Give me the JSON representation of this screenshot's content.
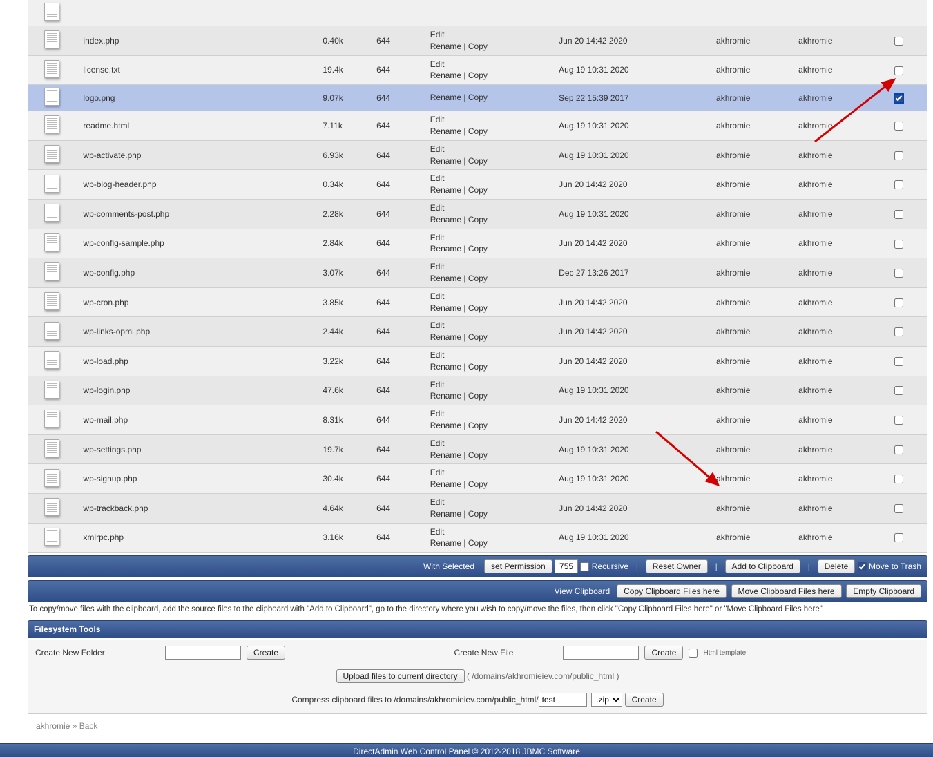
{
  "actions": {
    "edit": "Edit",
    "rename": "Rename",
    "copy": "Copy",
    "sep": " | "
  },
  "files": [
    {
      "name": "index.php",
      "size": "0.40k",
      "perms": "644",
      "hasEdit": true,
      "date": "Jun 20 14:42 2020",
      "uid": "akhromie",
      "gid": "akhromie",
      "selected": false
    },
    {
      "name": "license.txt",
      "size": "19.4k",
      "perms": "644",
      "hasEdit": true,
      "date": "Aug 19 10:31 2020",
      "uid": "akhromie",
      "gid": "akhromie",
      "selected": false
    },
    {
      "name": "logo.png",
      "size": "9.07k",
      "perms": "644",
      "hasEdit": false,
      "date": "Sep 22 15:39 2017",
      "uid": "akhromie",
      "gid": "akhromie",
      "selected": true
    },
    {
      "name": "readme.html",
      "size": "7.11k",
      "perms": "644",
      "hasEdit": true,
      "date": "Aug 19 10:31 2020",
      "uid": "akhromie",
      "gid": "akhromie",
      "selected": false
    },
    {
      "name": "wp-activate.php",
      "size": "6.93k",
      "perms": "644",
      "hasEdit": true,
      "date": "Aug 19 10:31 2020",
      "uid": "akhromie",
      "gid": "akhromie",
      "selected": false
    },
    {
      "name": "wp-blog-header.php",
      "size": "0.34k",
      "perms": "644",
      "hasEdit": true,
      "date": "Jun 20 14:42 2020",
      "uid": "akhromie",
      "gid": "akhromie",
      "selected": false
    },
    {
      "name": "wp-comments-post.php",
      "size": "2.28k",
      "perms": "644",
      "hasEdit": true,
      "date": "Aug 19 10:31 2020",
      "uid": "akhromie",
      "gid": "akhromie",
      "selected": false
    },
    {
      "name": "wp-config-sample.php",
      "size": "2.84k",
      "perms": "644",
      "hasEdit": true,
      "date": "Jun 20 14:42 2020",
      "uid": "akhromie",
      "gid": "akhromie",
      "selected": false
    },
    {
      "name": "wp-config.php",
      "size": "3.07k",
      "perms": "644",
      "hasEdit": true,
      "date": "Dec 27 13:26 2017",
      "uid": "akhromie",
      "gid": "akhromie",
      "selected": false
    },
    {
      "name": "wp-cron.php",
      "size": "3.85k",
      "perms": "644",
      "hasEdit": true,
      "date": "Jun 20 14:42 2020",
      "uid": "akhromie",
      "gid": "akhromie",
      "selected": false
    },
    {
      "name": "wp-links-opml.php",
      "size": "2.44k",
      "perms": "644",
      "hasEdit": true,
      "date": "Jun 20 14:42 2020",
      "uid": "akhromie",
      "gid": "akhromie",
      "selected": false
    },
    {
      "name": "wp-load.php",
      "size": "3.22k",
      "perms": "644",
      "hasEdit": true,
      "date": "Jun 20 14:42 2020",
      "uid": "akhromie",
      "gid": "akhromie",
      "selected": false
    },
    {
      "name": "wp-login.php",
      "size": "47.6k",
      "perms": "644",
      "hasEdit": true,
      "date": "Aug 19 10:31 2020",
      "uid": "akhromie",
      "gid": "akhromie",
      "selected": false
    },
    {
      "name": "wp-mail.php",
      "size": "8.31k",
      "perms": "644",
      "hasEdit": true,
      "date": "Jun 20 14:42 2020",
      "uid": "akhromie",
      "gid": "akhromie",
      "selected": false
    },
    {
      "name": "wp-settings.php",
      "size": "19.7k",
      "perms": "644",
      "hasEdit": true,
      "date": "Aug 19 10:31 2020",
      "uid": "akhromie",
      "gid": "akhromie",
      "selected": false
    },
    {
      "name": "wp-signup.php",
      "size": "30.4k",
      "perms": "644",
      "hasEdit": true,
      "date": "Aug 19 10:31 2020",
      "uid": "akhromie",
      "gid": "akhromie",
      "selected": false
    },
    {
      "name": "wp-trackback.php",
      "size": "4.64k",
      "perms": "644",
      "hasEdit": true,
      "date": "Jun 20 14:42 2020",
      "uid": "akhromie",
      "gid": "akhromie",
      "selected": false
    },
    {
      "name": "xmlrpc.php",
      "size": "3.16k",
      "perms": "644",
      "hasEdit": true,
      "date": "Aug 19 10:31 2020",
      "uid": "akhromie",
      "gid": "akhromie",
      "selected": false
    }
  ],
  "withSelected": {
    "label": "With Selected",
    "setPermission": "set Permission",
    "permValue": "755",
    "recursive": "Recursive",
    "resetOwner": "Reset Owner",
    "addClipboard": "Add to Clipboard",
    "delete": "Delete",
    "moveTrash": "Move to Trash"
  },
  "clipboardBar": {
    "view": "View Clipboard",
    "copyHere": "Copy Clipboard Files here",
    "moveHere": "Move Clipboard Files here",
    "empty": "Empty Clipboard"
  },
  "helpText": "To copy/move files with the clipboard, add the source files to the clipboard with \"Add to Clipboard\", go to the directory where you wish to copy/move the files, then click \"Copy Clipboard Files here\" or \"Move Clipboard Files here\"",
  "toolsHeader": "Filesystem Tools",
  "tools": {
    "newFolder": "Create New Folder",
    "newFile": "Create New File",
    "create": "Create",
    "htmlTemplate": "Html template",
    "upload": "Upload files to current directory",
    "uploadPath": "( /domains/akhromieiev.com/public_html )",
    "compressPrefix": "Compress clipboard files to /domains/akhromieiev.com/public_html/",
    "compressName": "test",
    "compressExtOptions": [
      ".zip"
    ],
    "compressExtSelected": ".zip",
    "compressDot": "."
  },
  "breadcrumb": {
    "user": "akhromie",
    "sep": " » ",
    "back": "Back"
  },
  "footer": "DirectAdmin Web Control Panel © 2012-2018 JBMC Software"
}
